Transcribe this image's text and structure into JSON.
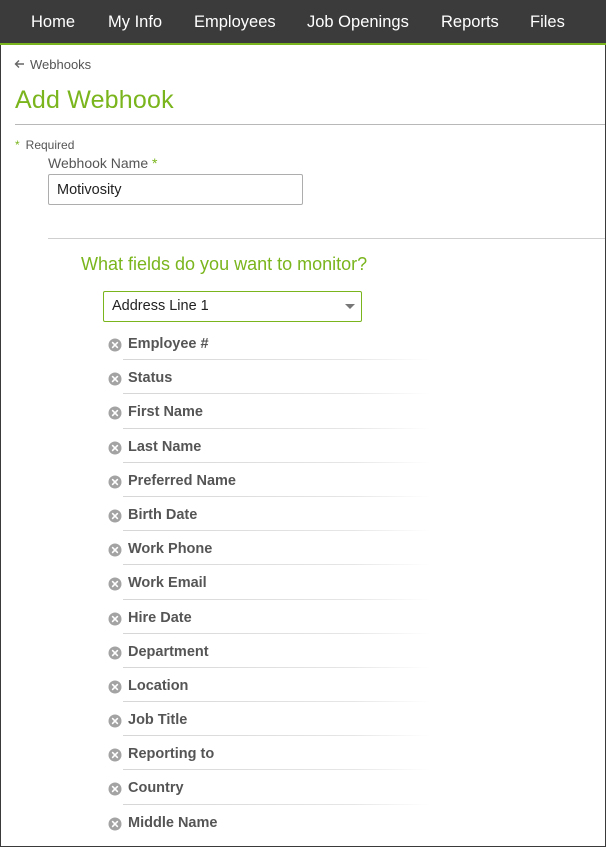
{
  "nav": {
    "items": [
      "Home",
      "My Info",
      "Employees",
      "Job Openings",
      "Reports",
      "Files"
    ]
  },
  "breadcrumb": {
    "label": "Webhooks",
    "icon": "arrow-left-icon"
  },
  "page": {
    "title": "Add Webhook"
  },
  "form": {
    "required_mark": "*",
    "required_label": "Required",
    "name_label": "Webhook Name",
    "name_value": "Motivosity"
  },
  "monitor": {
    "heading": "What fields do you want to monitor?",
    "select_value": "Address Line 1",
    "fields": [
      "Employee #",
      "Status",
      "First Name",
      "Last Name",
      "Preferred Name",
      "Birth Date",
      "Work Phone",
      "Work Email",
      "Hire Date",
      "Department",
      "Location",
      "Job Title",
      "Reporting to",
      "Country",
      "Middle Name"
    ]
  },
  "colors": {
    "brand_green": "#7ab51d",
    "nav_bg": "#3b3b3b",
    "remove_icon": "#9a9a9a"
  }
}
